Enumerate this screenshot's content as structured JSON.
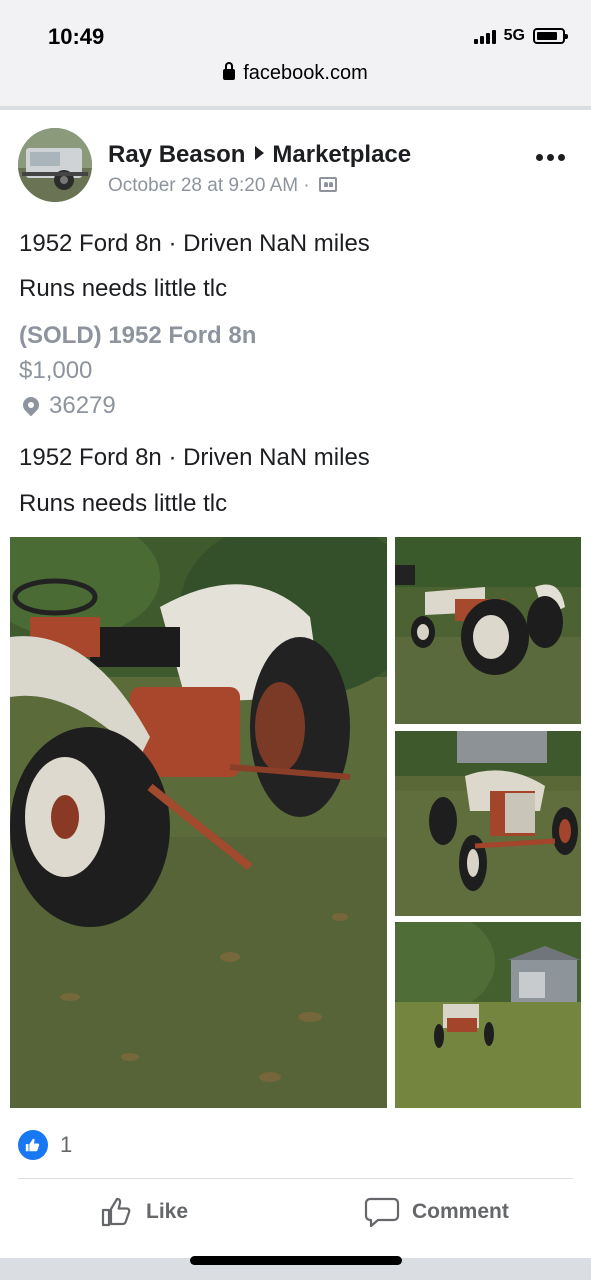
{
  "status_bar": {
    "time": "10:49",
    "network": "5G"
  },
  "browser": {
    "url": "facebook.com",
    "lock_icon": "lock-icon"
  },
  "post": {
    "author": "Ray Beason",
    "destination": "Marketplace",
    "timestamp": "October 28 at 9:20 AM ·",
    "audience_icon": "friends-audience-icon",
    "line1": "1952 Ford 8n · Driven NaN miles",
    "line2": "Runs needs little tlc",
    "listing": {
      "title": "(SOLD) 1952 Ford 8n",
      "price": "$1,000",
      "location": "36279"
    },
    "line3": "1952 Ford 8n · Driven NaN miles",
    "line4": "Runs needs little tlc",
    "photos": [
      "tractor-rear-closeup",
      "tractor-side-view",
      "tractor-front-view",
      "tractor-in-field-with-barn"
    ]
  },
  "reactions": {
    "count": "1",
    "icon": "thumbs-up-icon"
  },
  "actions": {
    "like_label": "Like",
    "comment_label": "Comment"
  },
  "colors": {
    "facebook_blue": "#1877f2",
    "secondary_text": "#8d949e",
    "action_text": "#65676b"
  }
}
